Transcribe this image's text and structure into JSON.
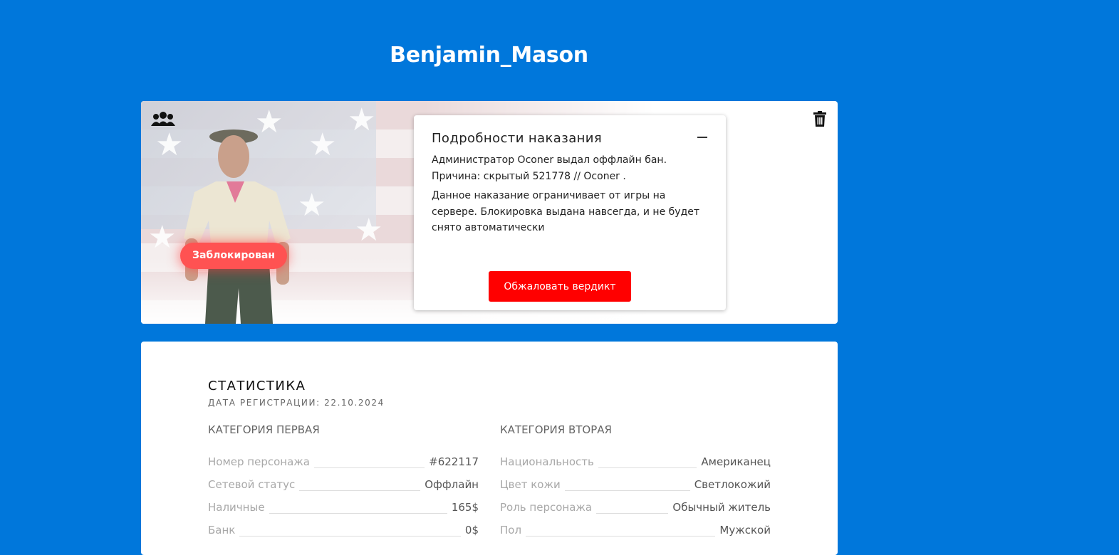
{
  "profile": {
    "name": "Benjamin_Mason",
    "status_badge": "Заблокирован"
  },
  "punishment": {
    "title": "Подробности наказания",
    "line1": "Администратор Oconer выдал оффлайн бан. Причина: скрытый 521778 // Oconer .",
    "line2": "Данное наказание ограничивает от игры на сервере. Блокировка выдана навсегда, и не будет снято автоматически",
    "appeal_button": "Обжаловать вердикт"
  },
  "stats": {
    "title": "СТАТИСТИКА",
    "registration": "ДАТА РЕГИСТРАЦИИ: 22.10.2024",
    "category1": {
      "title": "КАТЕГОРИЯ ПЕРВАЯ",
      "rows": [
        {
          "label": "Номер персонажа",
          "value": "#622117"
        },
        {
          "label": "Сетевой статус",
          "value": "Оффлайн"
        },
        {
          "label": "Наличные",
          "value": "165$"
        },
        {
          "label": "Банк",
          "value": "0$"
        }
      ]
    },
    "category2": {
      "title": "КАТЕГОРИЯ ВТОРАЯ",
      "rows": [
        {
          "label": "Национальность",
          "value": "Американец"
        },
        {
          "label": "Цвет кожи",
          "value": "Светлокожий"
        },
        {
          "label": "Роль персонажа",
          "value": "Обычный житель"
        },
        {
          "label": "Пол",
          "value": "Мужской"
        }
      ]
    }
  },
  "icons": {
    "group": "users-icon",
    "trash": "trash-icon",
    "collapse": "minus-icon"
  },
  "colors": {
    "background": "#0077db",
    "badge": "#ff5252",
    "appeal_button": "#ff0000"
  }
}
